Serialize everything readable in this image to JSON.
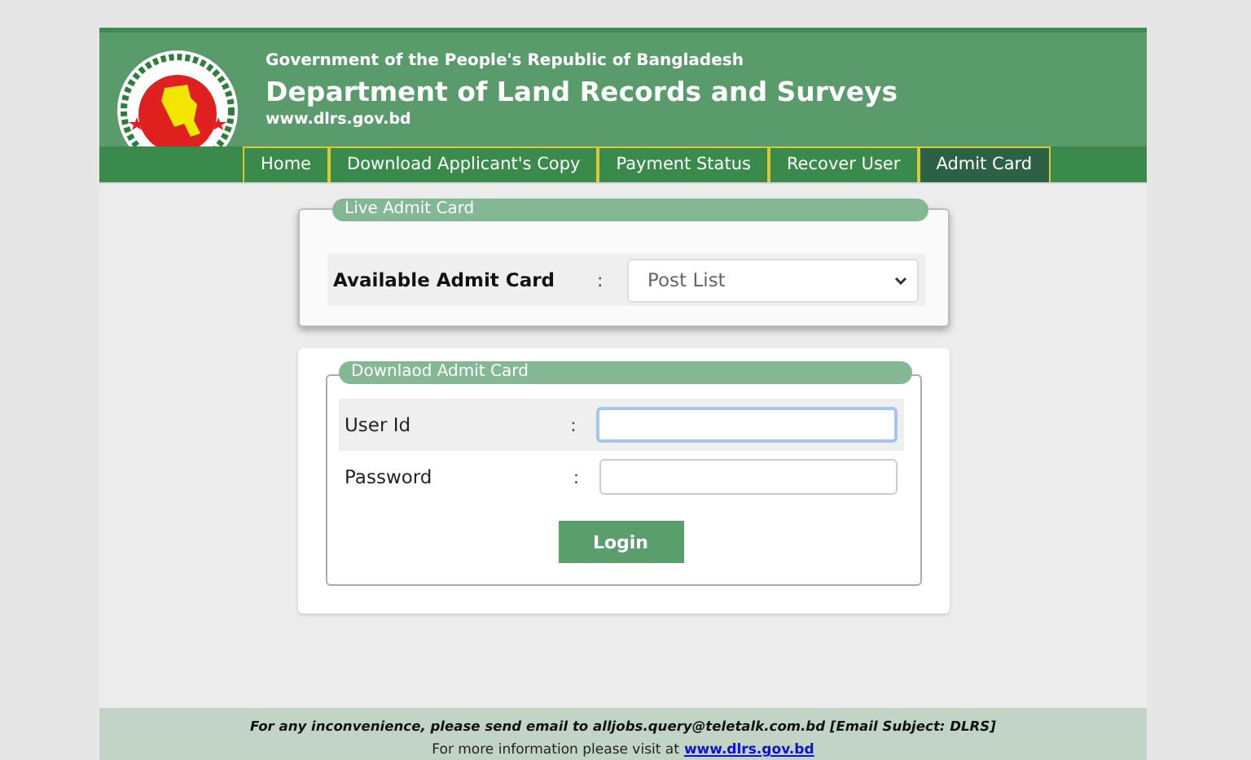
{
  "header": {
    "government": "Government of the People's Republic of Bangladesh",
    "department": "Department of Land Records and Surveys",
    "website": "www.dlrs.gov.bd"
  },
  "nav": [
    {
      "label": "Home",
      "selected": false
    },
    {
      "label": "Download Applicant's Copy",
      "selected": false
    },
    {
      "label": "Payment Status",
      "selected": false
    },
    {
      "label": "Recover User",
      "selected": false
    },
    {
      "label": "Admit Card",
      "selected": true
    }
  ],
  "live_admit_card": {
    "legend": "Live Admit Card",
    "label": "Available Admit Card",
    "separator": ":",
    "select_value": "Post List"
  },
  "download_admit_card": {
    "legend": "Downlaod Admit Card",
    "fields": [
      {
        "label": "User Id",
        "separator": ":",
        "focused": true
      },
      {
        "label": "Password",
        "separator": ":",
        "focused": false
      }
    ],
    "button": "Login"
  },
  "footer": {
    "notice": "For any inconvenience, please send email to alljobs.query@teletalk.com.bd [Email Subject: DLRS]",
    "info": "For more information please visit at",
    "link": "www.dlrs.gov.bd"
  }
}
